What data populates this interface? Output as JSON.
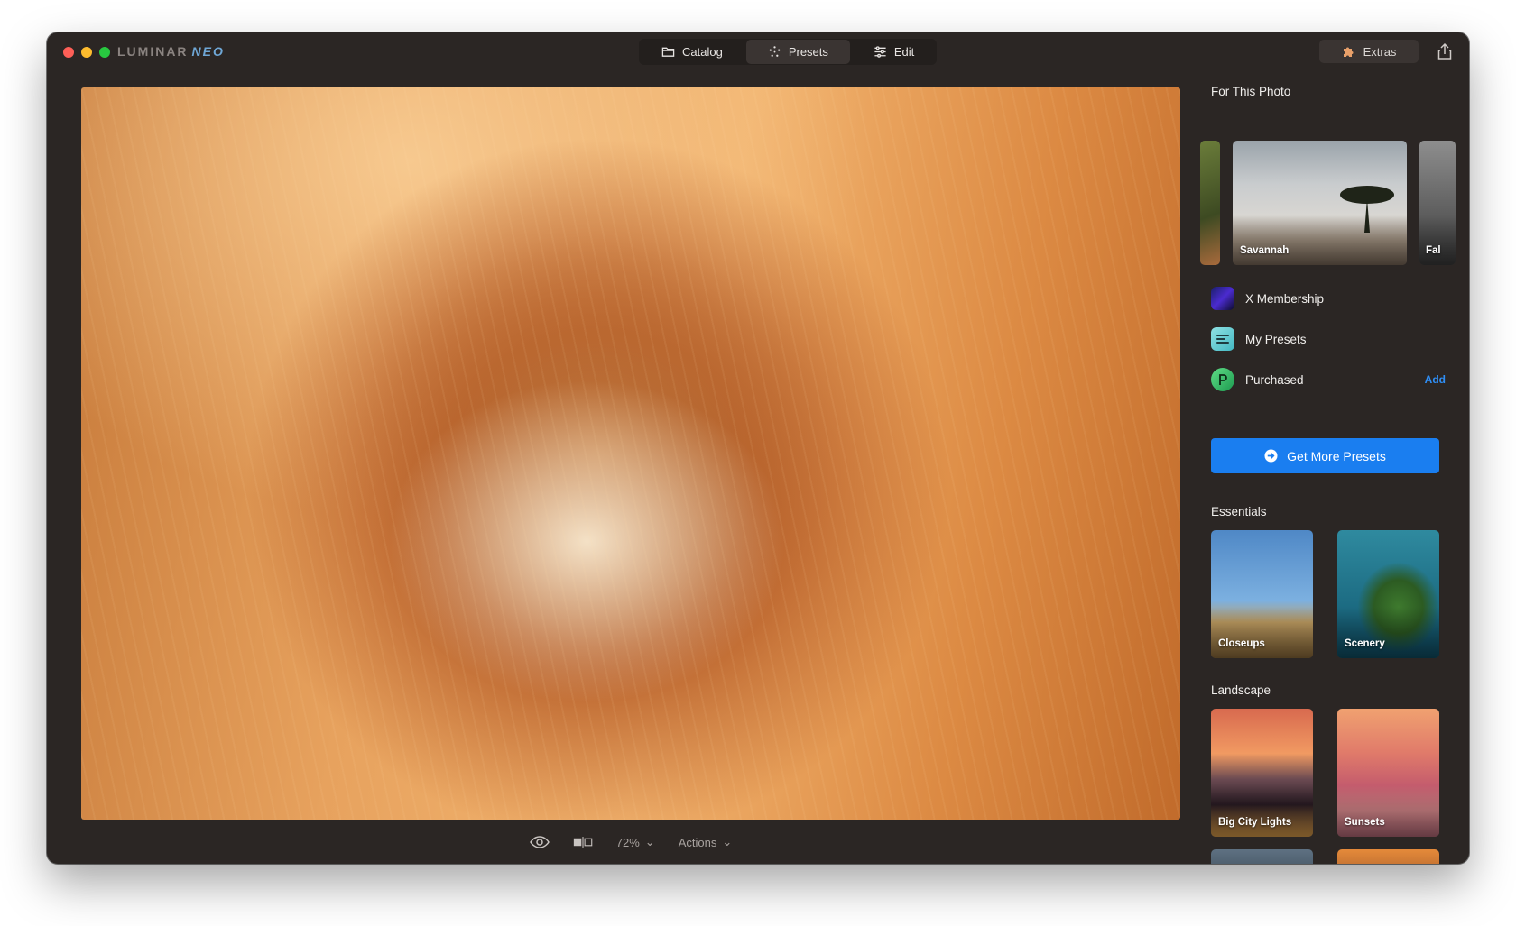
{
  "app": {
    "logo_part1": "LUMINAR",
    "logo_part2": "NEO"
  },
  "tabs": [
    {
      "label": "Catalog",
      "icon": "folder-icon",
      "active": false
    },
    {
      "label": "Presets",
      "icon": "sparkle-icon",
      "active": true
    },
    {
      "label": "Edit",
      "icon": "sliders-icon",
      "active": false
    }
  ],
  "toolbar": {
    "extras_label": "Extras",
    "share_icon": "share-icon"
  },
  "bottombar": {
    "zoom": "72%",
    "actions_label": "Actions"
  },
  "panel": {
    "for_this_photo_title": "For This Photo",
    "carousel": [
      {
        "label": ""
      },
      {
        "label": "Savannah"
      },
      {
        "label": "Fal"
      }
    ],
    "collections": [
      {
        "label": "X Membership",
        "icon": "x-membership-icon"
      },
      {
        "label": "My Presets",
        "icon": "my-presets-icon"
      },
      {
        "label": "Purchased",
        "icon": "purchased-icon",
        "action": "Add"
      }
    ],
    "cta_label": "Get More Presets",
    "essentials_title": "Essentials",
    "essentials": [
      {
        "label": "Closeups"
      },
      {
        "label": "Scenery"
      }
    ],
    "landscape_title": "Landscape",
    "landscape": [
      {
        "label": "Big City Lights"
      },
      {
        "label": "Sunsets"
      },
      {
        "label": ""
      },
      {
        "label": ""
      }
    ]
  },
  "colors": {
    "window_bg": "#2b2624",
    "accent_blue": "#1a7ef0",
    "add_link": "#2f8ef5"
  }
}
